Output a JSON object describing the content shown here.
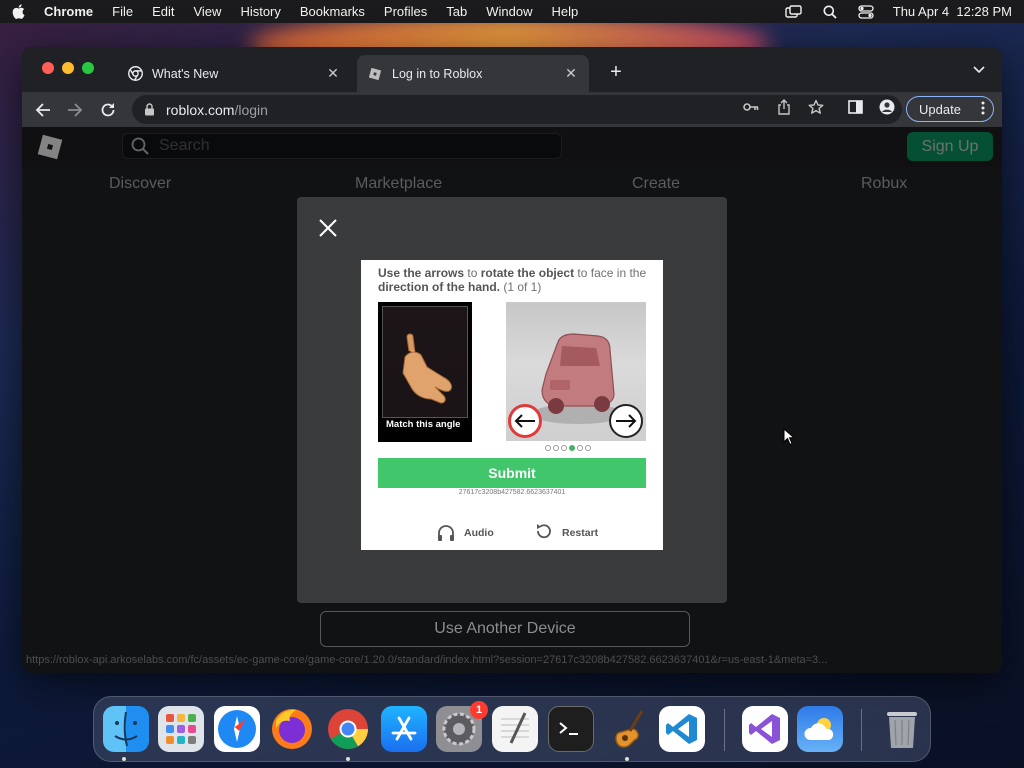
{
  "menubar": {
    "app_name": "Chrome",
    "items": [
      "File",
      "Edit",
      "View",
      "History",
      "Bookmarks",
      "Profiles",
      "Tab",
      "Window",
      "Help"
    ],
    "clock": "Thu Apr 4  12:28 PM"
  },
  "browser": {
    "tabs": [
      {
        "title": "What's New",
        "icon": "chrome-icon"
      },
      {
        "title": "Log in to Roblox",
        "icon": "roblox-icon"
      }
    ],
    "url_host": "roblox.com",
    "url_path": "/login",
    "update_label": "Update"
  },
  "roblox": {
    "search_placeholder": "Search",
    "signup_label": "Sign Up",
    "nav": [
      "Discover",
      "Marketplace",
      "Create",
      "Robux"
    ],
    "another_device_label": "Use Another Device",
    "status_url": "https://roblox-api.arkoselabs.com/fc/assets/ec-game-core/game-core/1.20.0/standard/index.html?session=27617c3208b427582.6623637401&r=us-east-1&meta=3..."
  },
  "captcha": {
    "instr_1": "Use the arrows",
    "instr_2": " to ",
    "instr_3": "rotate the object",
    "instr_4": " to face in the ",
    "instr_5": "direction of the hand.",
    "instr_6": " (1 of 1)",
    "match_label": "Match this angle",
    "submit_label": "Submit",
    "session_id": "27617c3208b427582.6623637401",
    "audio_label": "Audio",
    "restart_label": "Restart",
    "pager_total": 6,
    "pager_active": 4
  },
  "dock": {
    "apps": [
      "Finder",
      "Launchpad",
      "Safari",
      "Firefox",
      "Chrome",
      "App Store",
      "System Preferences",
      "TextEdit",
      "Terminal",
      "GarageBand",
      "Visual Studio Code",
      "Visual Studio",
      "Weather",
      "Trash"
    ],
    "settings_badge": "1"
  },
  "colors": {
    "signup": "#00b06f",
    "submit": "#41c66b",
    "update_border": "#8ab4f8"
  }
}
